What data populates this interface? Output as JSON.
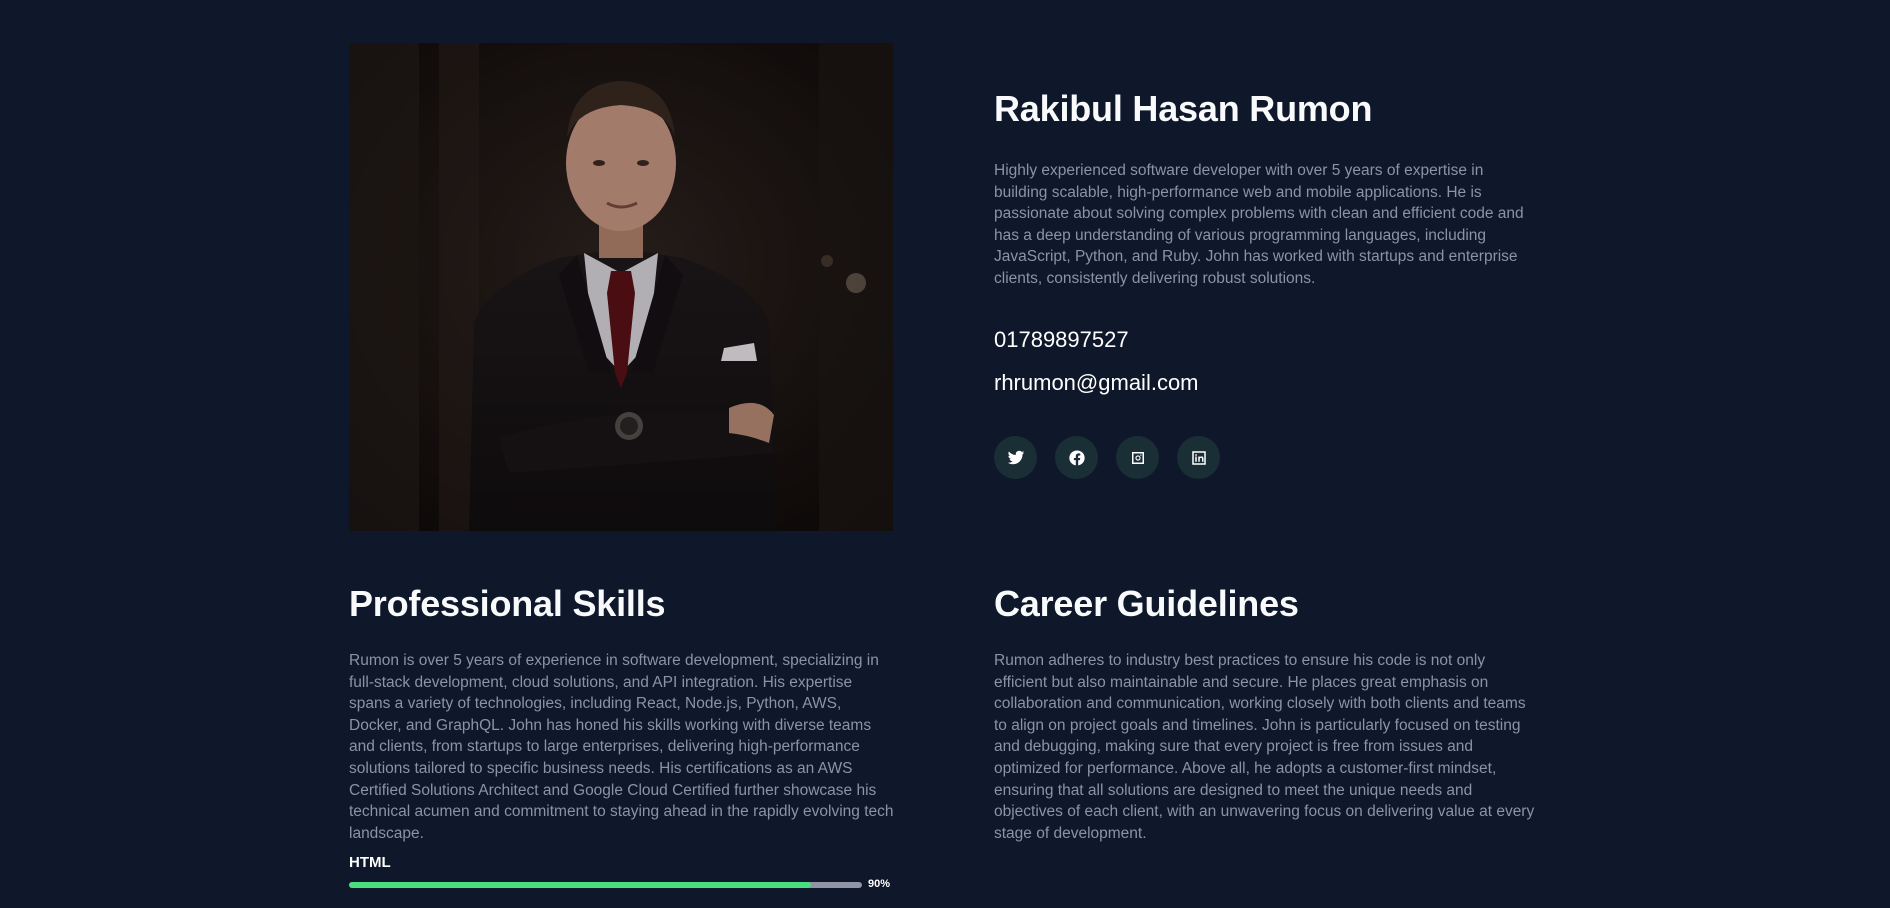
{
  "profile": {
    "name": "Rakibul Hasan Rumon",
    "bio": "Highly experienced software developer with over 5 years of expertise in building scalable, high-performance web and mobile applications. He is passionate about solving complex problems with clean and efficient code and has a deep understanding of various programming languages, including JavaScript, Python, and Ruby. John has worked with startups and enterprise clients, consistently delivering robust solutions.",
    "phone": "01789897527",
    "email": "rhrumon@gmail.com",
    "photo_icon": "person-in-suit-portrait"
  },
  "socials": [
    {
      "icon": "twitter-icon"
    },
    {
      "icon": "facebook-icon"
    },
    {
      "icon": "instagram-icon"
    },
    {
      "icon": "linkedin-icon"
    }
  ],
  "skills_section": {
    "title": "Professional Skills",
    "text": "Rumon is over 5 years of experience in software development, specializing in full-stack development, cloud solutions, and API integration. His expertise spans a variety of technologies, including React, Node.js, Python, AWS, Docker, and GraphQL. John has honed his skills working with diverse teams and clients, from startups to large enterprises, delivering high-performance solutions tailored to specific business needs. His certifications as an AWS Certified Solutions Architect and Google Cloud Certified further showcase his technical acumen and commitment to staying ahead in the rapidly evolving tech landscape.",
    "skills": [
      {
        "label": "HTML",
        "percent_text": "90%",
        "value": 0.9
      }
    ]
  },
  "career_section": {
    "title": "Career Guidelines",
    "text": "Rumon adheres to industry best practices to ensure his code is not only efficient but also maintainable and secure. He places great emphasis on collaboration and communication, working closely with both clients and teams to align on project goals and timelines. John is particularly focused on testing and debugging, making sure that every project is free from issues and optimized for performance. Above all, he adopts a customer-first mindset, ensuring that all solutions are designed to meet the unique needs and objectives of each client, with an unwavering focus on delivering value at every stage of development."
  },
  "colors": {
    "background": "#0f172a",
    "accent_green": "#4ade80",
    "social_bg": "#1a2e35",
    "muted_text": "#8b93a6"
  }
}
